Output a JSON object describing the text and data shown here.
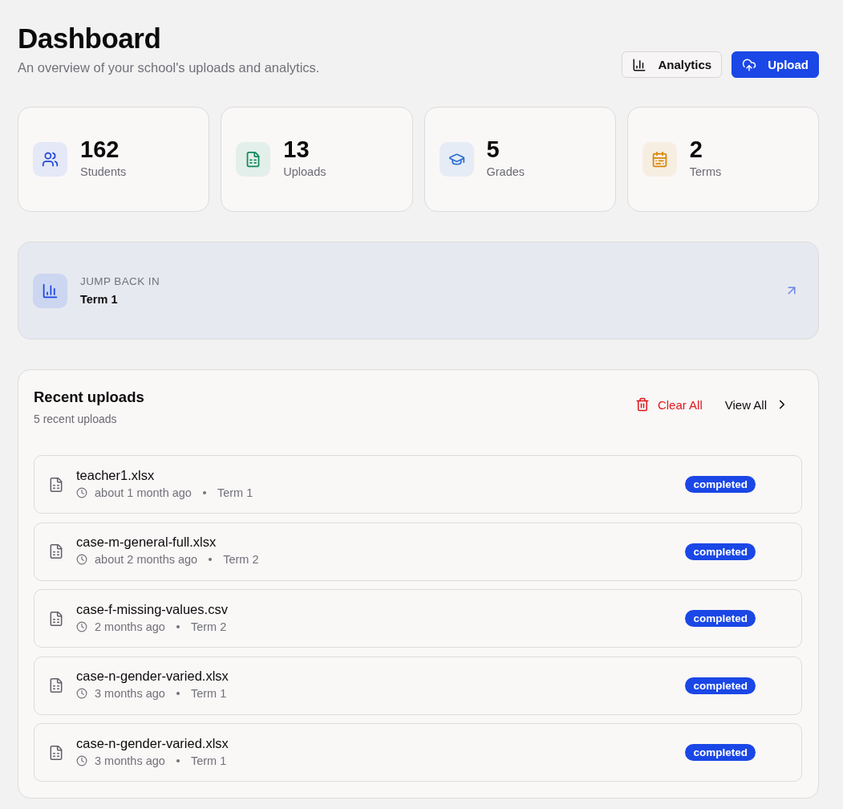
{
  "header": {
    "title": "Dashboard",
    "subtitle": "An overview of your school's uploads and analytics.",
    "actions": [
      {
        "label": "Analytics",
        "kind": "secondary"
      },
      {
        "label": "Upload",
        "kind": "primary"
      }
    ]
  },
  "stats": [
    {
      "value": "162",
      "label": "Students",
      "color": "#2046d8"
    },
    {
      "value": "13",
      "label": "Uploads",
      "color": "#108a5e"
    },
    {
      "value": "5",
      "label": "Grades",
      "color": "#2a6fd0"
    },
    {
      "value": "2",
      "label": "Terms",
      "color": "#d9860b"
    }
  ],
  "jump_back": {
    "eyebrow": "JUMP BACK IN",
    "title": "Term 1"
  },
  "recent_uploads": {
    "title": "Recent uploads",
    "subtitle": "5 recent uploads",
    "actions": [
      {
        "label": "Clear All",
        "kind": "danger"
      },
      {
        "label": "View All",
        "kind": "link"
      }
    ],
    "items": [
      {
        "filename": "teacher1.xlsx",
        "time": "about 1 month ago",
        "term": "Term 1",
        "status": "completed"
      },
      {
        "filename": "case-m-general-full.xlsx",
        "time": "about 2 months ago",
        "term": "Term 2",
        "status": "completed"
      },
      {
        "filename": "case-f-missing-values.csv",
        "time": "2 months ago",
        "term": "Term 2",
        "status": "completed"
      },
      {
        "filename": "case-n-gender-varied.xlsx",
        "time": "3 months ago",
        "term": "Term 1",
        "status": "completed"
      },
      {
        "filename": "case-n-gender-varied.xlsx",
        "time": "3 months ago",
        "term": "Term 1",
        "status": "completed"
      }
    ]
  }
}
